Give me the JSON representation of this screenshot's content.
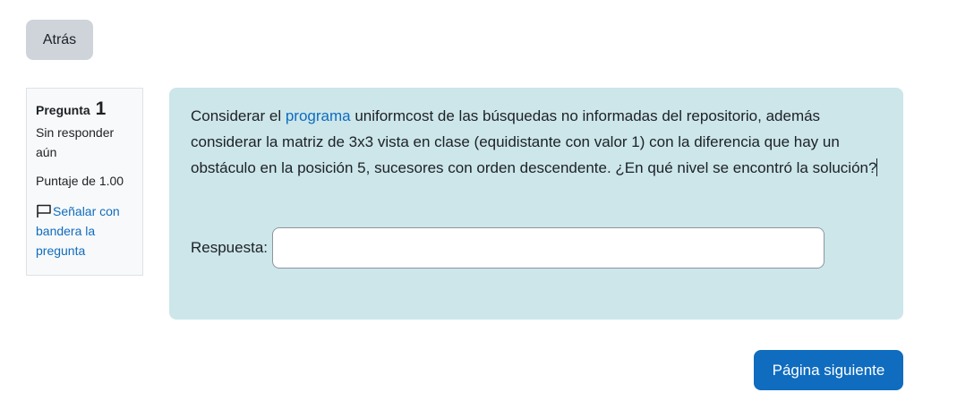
{
  "nav": {
    "back_label": "Atrás",
    "next_label": "Página siguiente"
  },
  "info": {
    "question_word": "Pregunta",
    "question_number": "1",
    "status": "Sin responder aún",
    "grade": "Puntaje de 1.00",
    "flag_label": "Señalar con bandera la pregunta",
    "flag_icon": "flag-icon"
  },
  "question": {
    "text_before_link": "Considerar el ",
    "link_text": "programa",
    "text_after_link": " uniformcost de las búsquedas no informadas del repositorio, además considerar la matriz de 3x3 vista en clase (equidistante con valor 1) con la diferencia que hay un obstáculo en la posición 5, sucesores con orden descendente. ¿En qué nivel se encontró la solución?"
  },
  "answer": {
    "label": "Respuesta:",
    "value": ""
  },
  "colors": {
    "primary": "#0f6cbf",
    "question_bg": "#cce6ea",
    "secondary_button": "#ced4da",
    "info_bg": "#f8f9fa"
  }
}
